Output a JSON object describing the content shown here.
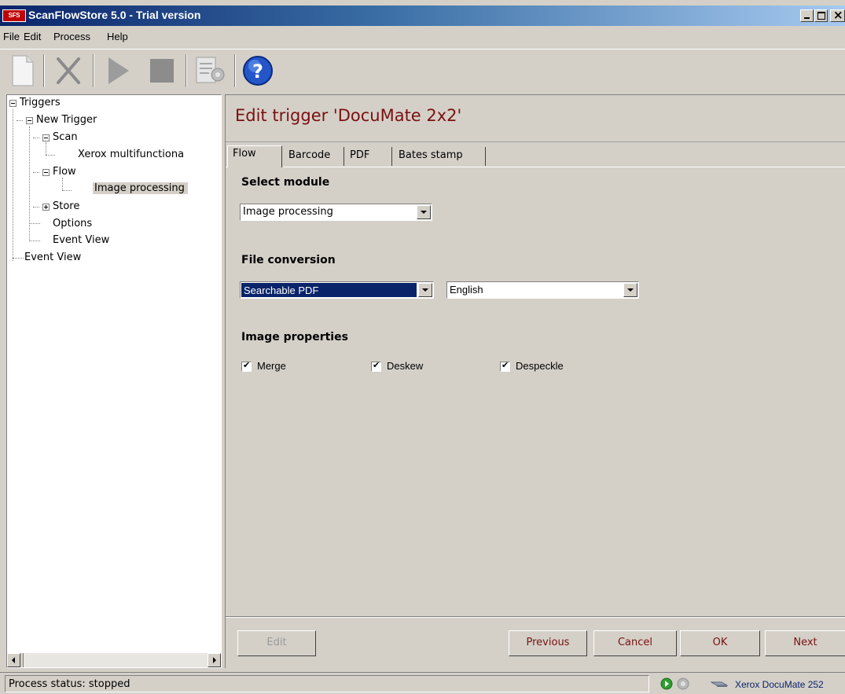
{
  "window": {
    "title": "ScanFlowStore 5.0 - Trial version",
    "app_icon_text": "SFS"
  },
  "menu": {
    "file": "File",
    "edit": "Edit",
    "process": "Process",
    "help": "Help"
  },
  "toolbar": {
    "icons": [
      "new-document-icon",
      "delete-icon",
      "play-icon",
      "stop-icon",
      "settings-document-icon",
      "help-icon"
    ],
    "help_glyph": "?"
  },
  "tree": {
    "triggers": "Triggers",
    "new_trigger": "New Trigger",
    "scan": "Scan",
    "scanner": "Xerox multifunctiona",
    "flow": "Flow",
    "image_processing": "Image processing",
    "store": "Store",
    "options": "Options",
    "event_view_child": "Event View",
    "event_view_root": "Event View"
  },
  "panel": {
    "title": "Edit trigger 'DocuMate 2x2'",
    "tabs": {
      "flow": "Flow",
      "barcode": "Barcode",
      "pdf": "PDF",
      "bates": "Bates stamp"
    },
    "select_module_label": "Select module",
    "module_value": "Image processing",
    "file_conversion_label": "File conversion",
    "conversion_value": "Searchable PDF",
    "language_value": "English",
    "image_properties_label": "Image properties",
    "checkboxes": {
      "merge": "Merge",
      "deskew": "Deskew",
      "despeckle": "Despeckle"
    }
  },
  "buttons": {
    "edit": "Edit",
    "previous": "Previous",
    "cancel": "Cancel",
    "ok": "OK",
    "next": "Next"
  },
  "status": {
    "text": "Process status: stopped",
    "device": "Xerox DocuMate 252"
  },
  "colors": {
    "title_red": "#7a1010",
    "selection_blue": "#0a246a",
    "chrome": "#d4d0c8"
  }
}
